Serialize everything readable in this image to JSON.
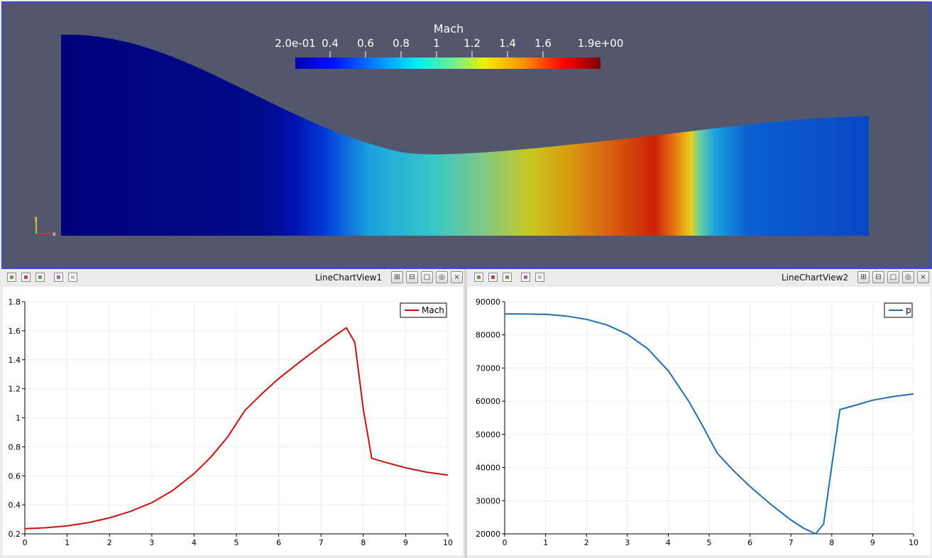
{
  "render_view": {
    "scalar_bar": {
      "title": "Mach",
      "labels": [
        "2.0e-01",
        "0.4",
        "0.6",
        "0.8",
        "1",
        "1.2",
        "1.4",
        "1.6",
        "1.9e+00"
      ]
    },
    "axes_labels": {
      "x": "x",
      "y": "y"
    }
  },
  "toolbar_left": {
    "title": "LineChartView1",
    "icons": [
      "select-points-icon",
      "select-cells-icon",
      "select-points-on-icon",
      "select-mesh-icon",
      "clear-selection-icon"
    ]
  },
  "toolbar_right": {
    "title": "LineChartView2",
    "icons": [
      "select-points-icon",
      "select-cells-icon",
      "select-points-on-icon",
      "select-mesh-icon",
      "clear-selection-icon"
    ]
  },
  "view_buttons": {
    "split_horizontal": "⊞",
    "split_vertical": "⊟",
    "maximize": "□",
    "capture": "◎",
    "close": "×"
  },
  "colors": {
    "render_background": "#52576e",
    "mach_series": "#cc1010",
    "p_series": "#1f6fae",
    "active_view_border": "#3c4ad8"
  },
  "chart_data": [
    {
      "type": "line",
      "title": "",
      "xlabel": "",
      "ylabel": "",
      "xlim": [
        0,
        10
      ],
      "ylim": [
        0.2,
        1.8
      ],
      "x_ticks": [
        "0",
        "1",
        "2",
        "3",
        "4",
        "5",
        "6",
        "7",
        "8",
        "9",
        "10"
      ],
      "y_ticks": [
        "0.2",
        "0.4",
        "0.6",
        "0.8",
        "1",
        "1.2",
        "1.4",
        "1.6",
        "1.8"
      ],
      "grid": true,
      "legend": "top-right",
      "series": [
        {
          "name": "Mach",
          "color": "#cc1010",
          "x": [
            0,
            0.5,
            1,
            1.5,
            2,
            2.5,
            3,
            3.5,
            4,
            4.4,
            4.8,
            5.2,
            5.6,
            6,
            6.5,
            7,
            7.3,
            7.6,
            7.8,
            8.0,
            8.2,
            8.5,
            9,
            9.5,
            10
          ],
          "y": [
            0.235,
            0.242,
            0.255,
            0.277,
            0.31,
            0.355,
            0.415,
            0.5,
            0.615,
            0.73,
            0.87,
            1.05,
            1.165,
            1.27,
            1.385,
            1.495,
            1.56,
            1.62,
            1.52,
            1.06,
            0.72,
            0.695,
            0.655,
            0.625,
            0.605
          ]
        }
      ]
    },
    {
      "type": "line",
      "title": "",
      "xlabel": "",
      "ylabel": "",
      "xlim": [
        0,
        10
      ],
      "ylim": [
        20000,
        90000
      ],
      "x_ticks": [
        "0",
        "1",
        "2",
        "3",
        "4",
        "5",
        "6",
        "7",
        "8",
        "9",
        "10"
      ],
      "y_ticks": [
        "20000",
        "30000",
        "40000",
        "50000",
        "60000",
        "70000",
        "80000",
        "90000"
      ],
      "grid": true,
      "legend": "top-right",
      "series": [
        {
          "name": "p",
          "color": "#1f6fae",
          "x": [
            0,
            0.5,
            1,
            1.5,
            2,
            2.5,
            3,
            3.5,
            4,
            4.5,
            4.8,
            5.2,
            5.6,
            6,
            6.5,
            7,
            7.3,
            7.6,
            7.8,
            8.0,
            8.2,
            8.5,
            9,
            9.5,
            10
          ],
          "y": [
            86300,
            86300,
            86200,
            85700,
            84700,
            83000,
            80200,
            75800,
            69200,
            60000,
            53500,
            44300,
            39000,
            34300,
            29000,
            24200,
            21800,
            20000,
            23000,
            40500,
            57500,
            58500,
            60300,
            61400,
            62200
          ]
        }
      ]
    }
  ]
}
